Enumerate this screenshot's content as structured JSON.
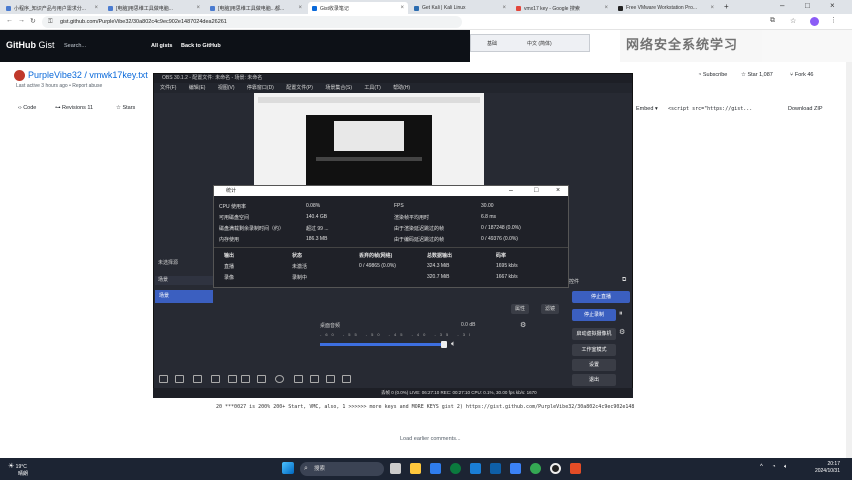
{
  "browser": {
    "tabs": [
      {
        "label": "小程序_知识产品与用户需求分..."
      },
      {
        "label": "[电脑]用思维工具做电脑..."
      },
      {
        "label": "[电脑]用思维工具做电脑...都..."
      },
      {
        "label": "Gist收录笔记"
      },
      {
        "label": "Get Kali | Kali Linux"
      },
      {
        "label": "vmx17 key - Google 搜索"
      },
      {
        "label": "Free VMware Workstation Pro..."
      }
    ],
    "url": "gist.github.com/PurpleVibe32/30a802c4c9ec902e1487024dea26261"
  },
  "github": {
    "logo": "GitHub",
    "logo_suffix": "Gist",
    "search_placeholder": "Search...",
    "nav_all_gists": "All gists",
    "nav_back": "Back to GitHub"
  },
  "gist": {
    "title": "PurpleVibe32 / vmwk17key.txt",
    "subtitle": "Last active 3 hours ago • Report abuse",
    "tab_code": "Code",
    "tab_revisions": "Revisions",
    "revisions_count": "11",
    "tab_stars": "Stars",
    "subscribe": "Subscribe",
    "star": "Star",
    "star_count": "1,087",
    "fork": "Fork",
    "fork_count": "46",
    "embed": "Embed",
    "embed_code": "<script src=\"https://gist...",
    "download": "Download ZIP",
    "code_line": "20   ***0027 is 200% 200+ Start, VMC, also, 1 >>>>>> more keys and MORE KEYS gist 2) https://gist.github.com/PurpleVibe32/30a802c4c9ec902e148",
    "load_comments": "Load earlier comments..."
  },
  "overlay": {
    "left_tabs": [
      "基础",
      "中文 (简体)"
    ],
    "watermark": "网络安全系统学习"
  },
  "obs": {
    "title": "OBS 30.1.2 - 配置文件: 未命名 - 场景: 未命名",
    "menu": [
      "文件(F)",
      "编辑(E)",
      "视图(V)",
      "停靠窗口(D)",
      "配置文件(P)",
      "场景集合(S)",
      "工具(T)",
      "帮助(H)"
    ],
    "stats": {
      "title": "统计",
      "rows_left": [
        {
          "label": "CPU 使用率",
          "value": "0.08%"
        },
        {
          "label": "可用磁盘空间",
          "value": "140.4 GB"
        },
        {
          "label": "磁盘满载剩余录制时间（约）",
          "value": "超过 99 ..."
        },
        {
          "label": "内存使用",
          "value": "186.3 MB"
        }
      ],
      "rows_right": [
        {
          "label": "FPS",
          "value": "30.00"
        },
        {
          "label": "渲染帧平均用时",
          "value": "6.8 ms"
        },
        {
          "label": "由于渲染延迟跳过的帧",
          "value": "0 / 187248 (0.0%)"
        },
        {
          "label": "由于编码延迟跳过的帧",
          "value": "0 / 49376 (0.0%)"
        }
      ],
      "output_headers": [
        "输出",
        "状态",
        "丢弃的帧(网络)",
        "总数据输出",
        "码率"
      ],
      "output_rows": [
        {
          "name": "直播",
          "status": "未激活",
          "dropped": "0 / 49865 (0.0%)",
          "total": "324.3 MiB",
          "bitrate": "1695 kb/s"
        },
        {
          "name": "录像",
          "status": "录制中",
          "dropped": "",
          "total": "320.7 MiB",
          "bitrate": "1667 kb/s"
        }
      ]
    },
    "scenes_label": "未选择源",
    "scenes_header": "场景",
    "scene_selected": "场景",
    "filters_btn": "属性",
    "settings_btn": "滤镜",
    "mixer_label": "混音器",
    "mixer_device": "桌面音频",
    "mixer_db": "0.0 dB",
    "mixer_ticks": "-60 -55 -50 -45 -40 -35 -30 -25 -20 -15 -10 -5 0",
    "controls_label": "控件",
    "controls": [
      "停止直播",
      "停止录制",
      "启动虚拟摄像机",
      "工作室模式",
      "设置",
      "退出"
    ],
    "status_bar": "丢帧 0 (0.0%)   LIVE: 06:27:10   REC: 00:27:10   CPU: 0.1%, 30.00 fps   kb/s: 1670"
  },
  "taskbar": {
    "weather_temp": "19°C",
    "weather_desc": "晴朗",
    "search": "搜索",
    "time": "20:17",
    "date": "2024/10/31"
  }
}
